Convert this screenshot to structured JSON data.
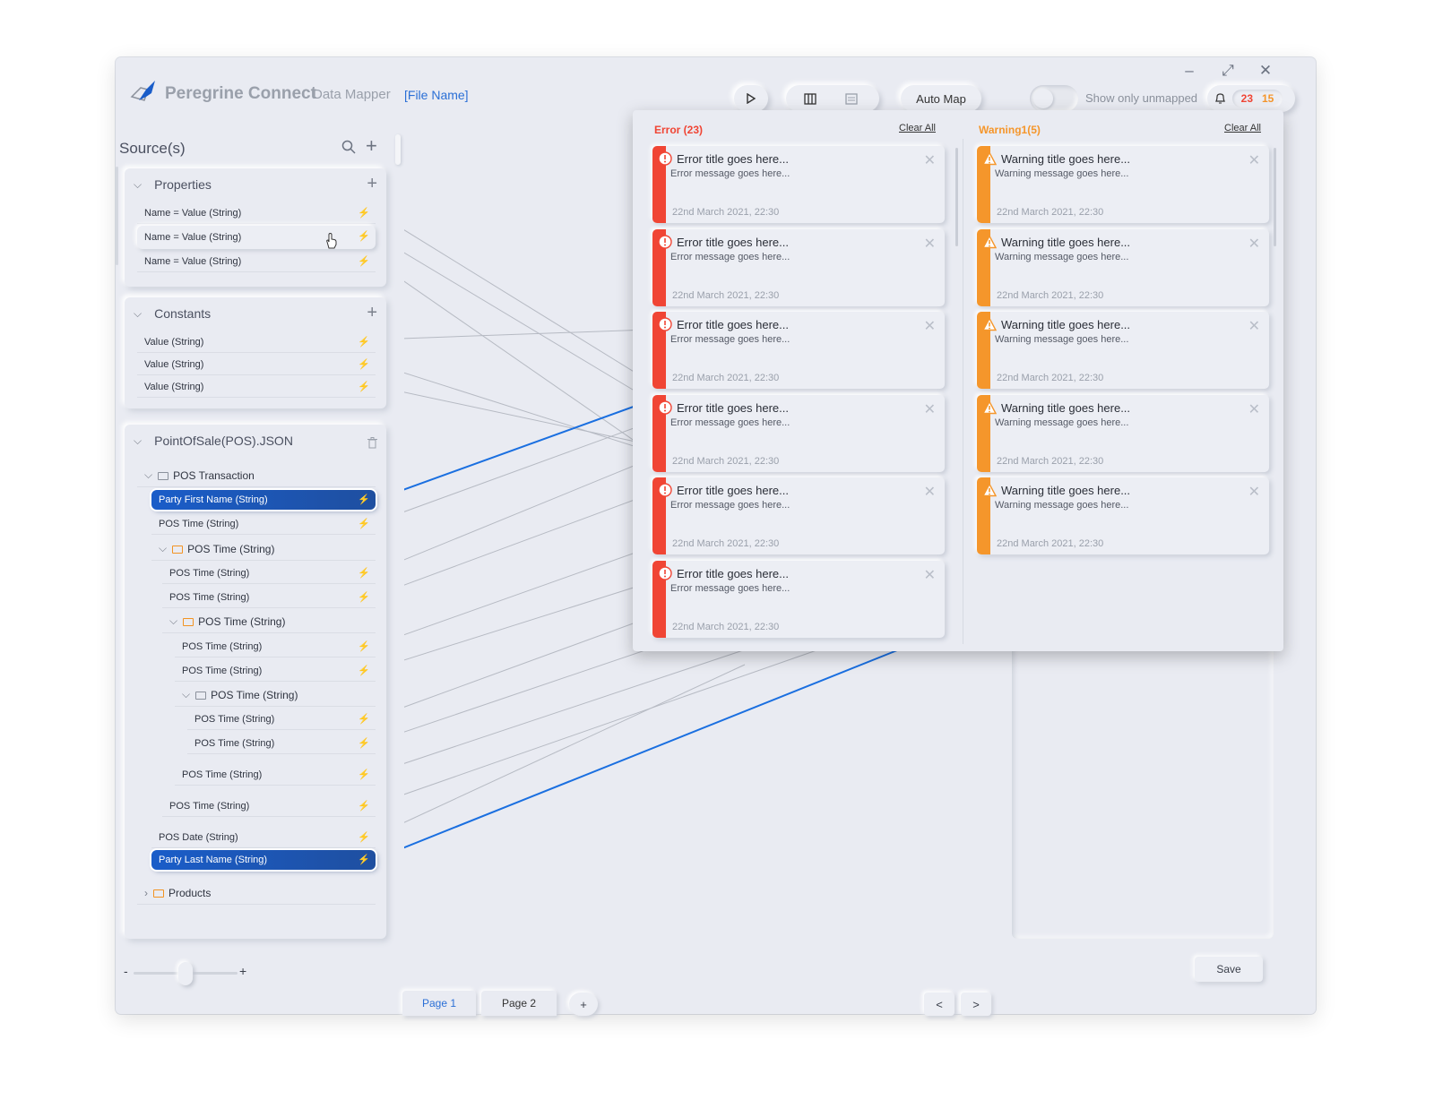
{
  "app": {
    "brand": "Peregrine Connect",
    "module": "Data Mapper",
    "file_name": "[File Name]"
  },
  "toolbar": {
    "auto_map": "Auto Map",
    "show_unmapped": "Show only unmapped",
    "error_count": "23",
    "warning_count": "15"
  },
  "source": {
    "title": "Source(s)",
    "properties": {
      "title": "Properties",
      "rows": [
        "Name = Value (String)",
        "Name = Value (String)",
        "Name = Value (String)"
      ]
    },
    "constants": {
      "title": "Constants",
      "rows": [
        "Value (String)",
        "Value (String)",
        "Value (String)"
      ]
    },
    "schema": {
      "title": "PointOfSale(POS).JSON",
      "items": [
        "POS Transaction",
        "Party First Name (String)",
        "POS Time (String)",
        "POS Time (String)",
        "POS Time (String)",
        "POS Time (String)",
        "POS Time (String)",
        "POS Time (String)",
        "POS Time (String)",
        "POS Time (String)",
        "POS Time (String)",
        "POS Time (String)",
        "POS Time (String)",
        "POS Time (String)",
        "POS Date (String)",
        "Party Last Name (String)",
        "Products"
      ]
    }
  },
  "pages": {
    "tabs": [
      "Page 1",
      "Page 2"
    ],
    "add": "+",
    "prev": "<",
    "next": ">"
  },
  "zoom": {
    "minus": "-",
    "plus": "+"
  },
  "save": "Save",
  "notifications": {
    "errors": {
      "header": "Error (23)",
      "clear": "Clear All",
      "title": "Error title goes here...",
      "message": "Error message goes here...",
      "date": "22nd March 2021, 22:30",
      "count_visible": 6
    },
    "warnings": {
      "header": "Warning1(5)",
      "clear": "Clear All",
      "title": "Warning title goes here...",
      "message": "Warning message goes here...",
      "date": "22nd March 2021, 22:30",
      "count_visible": 5
    }
  },
  "colors": {
    "error": "#f04534",
    "warning": "#f5962b",
    "accent": "#1a5dc9"
  }
}
